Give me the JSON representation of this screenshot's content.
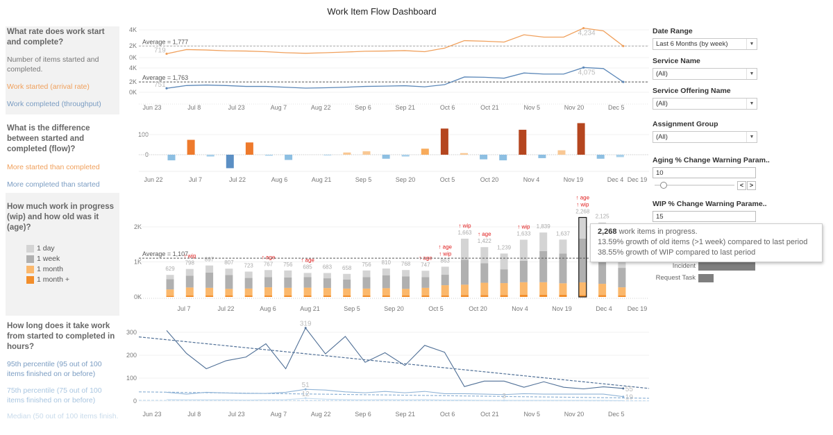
{
  "title": "Work Item Flow Dashboard",
  "left_panel": {
    "q1": {
      "heading": "What rate does work start and complete?",
      "sub": "Number of items started and completed.",
      "legend_started": "Work started (arrival rate)",
      "legend_completed": "Work completed (throughput)"
    },
    "q2": {
      "heading": "What is the difference between started and completed (flow)?",
      "more_started": "More started than completed",
      "more_completed": "More completed than started"
    },
    "q3": {
      "heading": "How much work in progress (wip) and how old was it (age)?",
      "legend": [
        {
          "label": "1 day",
          "color": "#d4d4d4"
        },
        {
          "label": "1 week",
          "color": "#b0b0b0"
        },
        {
          "label": "1 month",
          "color": "#fbb86c"
        },
        {
          "label": "1 month +",
          "color": "#f28e2b"
        }
      ]
    },
    "q4": {
      "heading": "How long does it take work from started to completed in hours?",
      "p95": "95th percentile (95 out of 100 items finished on or before)",
      "p75": "75th percentile (75 out of 100 items finished on or before)",
      "median": "Median (50 out of 100 items finish.."
    }
  },
  "filters": {
    "date_range": {
      "label": "Date Range",
      "value": "Last 6 Months (by week)"
    },
    "service_name": {
      "label": "Service Name",
      "value": "(All)"
    },
    "service_offering": {
      "label": "Service Offering Name",
      "value": "(All)"
    },
    "assignment_group": {
      "label": "Assignment Group",
      "value": "(All)"
    },
    "aging_param": {
      "label": "Aging % Change Warning Param..",
      "value": "10",
      "slider_fraction": 0.1,
      "prev": "<",
      "next": ">"
    },
    "wip_param": {
      "label": "WIP % Change Warning Parame..",
      "value": "15"
    }
  },
  "tooltip": {
    "count": "2,268",
    "line1": " work items in progress.",
    "line2": "13.59% growth of old items (>1 week) compared to last period",
    "line3": "38.55% growth of WIP compared to last period"
  },
  "type_bars": [
    {
      "label": "Incident",
      "relative": 1.0
    },
    {
      "label": "Request Task",
      "relative": 0.27
    }
  ],
  "colors": {
    "started": "#f0a05c",
    "completed": "#5b87b8",
    "warning": "#e02020"
  },
  "chart_data": [
    {
      "type": "line",
      "x_ticks": [
        "Jun 23",
        "Jul 8",
        "Jul 23",
        "Aug 7",
        "Aug 22",
        "Sep 6",
        "Sep 21",
        "Oct 6",
        "Oct 21",
        "Nov 5",
        "Nov 20",
        "Dec 5"
      ],
      "y_ticks": [
        "4K",
        "2K",
        "0K"
      ],
      "series": [
        {
          "name": "Work started (arrival rate)",
          "color": "#f0a05c",
          "average_label": "Average = 1,777",
          "average": 1777,
          "values": [
            719,
            1290,
            1230,
            1120,
            1090,
            1000,
            860,
            780,
            860,
            950,
            1060,
            1090,
            1150,
            1000,
            1490,
            2520,
            2440,
            2320,
            3320,
            3000,
            3000,
            4234,
            3860,
            1777
          ],
          "labels": {
            "0": "719",
            "21": "4,234"
          }
        },
        {
          "name": "Work completed (throughput)",
          "color": "#5b87b8",
          "average_label": "Average = 1,763",
          "average": 1763,
          "values": [
            751,
            1190,
            1270,
            1190,
            1050,
            1050,
            920,
            780,
            830,
            920,
            1050,
            1100,
            1160,
            990,
            1330,
            2560,
            2510,
            2370,
            3200,
            3030,
            3030,
            4075,
            3910,
            1763
          ],
          "labels": {
            "0": "751",
            "21": "4,075"
          }
        }
      ]
    },
    {
      "type": "bar",
      "x_ticks": [
        "Jun 22",
        "Jul 7",
        "Jul 22",
        "Aug 6",
        "Aug 21",
        "Sep 5",
        "Sep 20",
        "Oct 5",
        "Oct 20",
        "Nov 4",
        "Nov 19",
        "Dec 4",
        "Dec 19"
      ],
      "y_ticks": [
        {
          "label": "100",
          "value": 100
        },
        {
          "label": "0",
          "value": 0
        }
      ],
      "values": [
        -28,
        74,
        -9,
        -67,
        61,
        -5,
        -26,
        0,
        -2,
        11,
        17,
        -20,
        -9,
        30,
        130,
        8,
        -23,
        -28,
        124,
        -17,
        22,
        157,
        -20,
        -12
      ]
    },
    {
      "type": "bar",
      "stacked": true,
      "x_ticks": [
        "Jul 7",
        "Jul 22",
        "Aug 6",
        "Aug 21",
        "Sep 5",
        "Sep 20",
        "Oct 5",
        "Oct 20",
        "Nov 4",
        "Nov 19",
        "Dec 4",
        "Dec 19"
      ],
      "y_ticks": [
        {
          "label": "2K",
          "value": 2000
        },
        {
          "label": "1K",
          "value": 1000
        },
        {
          "label": "0K",
          "value": 0
        }
      ],
      "average_label": "Average = 1,107",
      "average": 1107,
      "totals": [
        629,
        798,
        897,
        807,
        723,
        767,
        756,
        685,
        683,
        658,
        756,
        810,
        768,
        747,
        863,
        1663,
        1422,
        1239,
        1633,
        1839,
        1637,
        2268,
        2125,
        1050
      ],
      "total_labels": [
        "629",
        "798",
        "897",
        "807",
        "723",
        "767",
        "756",
        "685",
        "683",
        "658",
        "756",
        "810",
        "768",
        "747",
        "863",
        "1,663",
        "1,422",
        "1,239",
        "1,633",
        "1,839",
        "1,637",
        "2,268",
        "2,125",
        ""
      ],
      "series": [
        {
          "name": "1 month +",
          "color": "#f28e2b",
          "values": [
            35,
            40,
            40,
            40,
            40,
            45,
            40,
            45,
            45,
            40,
            40,
            40,
            40,
            40,
            45,
            50,
            55,
            55,
            60,
            60,
            60,
            55,
            55,
            45
          ]
        },
        {
          "name": "1 month",
          "color": "#fbb86c",
          "values": [
            180,
            230,
            220,
            190,
            200,
            230,
            220,
            220,
            210,
            200,
            200,
            210,
            190,
            220,
            290,
            300,
            350,
            340,
            360,
            360,
            330,
            360,
            320,
            230
          ]
        },
        {
          "name": "1 week",
          "color": "#b0b0b0",
          "values": [
            294,
            338,
            437,
            397,
            303,
            292,
            296,
            300,
            278,
            258,
            326,
            370,
            358,
            307,
            298,
            713,
            557,
            394,
            613,
            889,
            847,
            1253,
            1300,
            555
          ]
        },
        {
          "name": "1 day",
          "color": "#d4d4d4",
          "values": [
            120,
            190,
            200,
            180,
            180,
            200,
            200,
            120,
            150,
            160,
            190,
            190,
            180,
            180,
            230,
            600,
            460,
            450,
            600,
            530,
            400,
            600,
            450,
            220
          ]
        }
      ],
      "selected_index": 21,
      "annotations": {
        "1": [
          "↑ wip"
        ],
        "5": [
          "↑ age"
        ],
        "7": [
          "↑ age"
        ],
        "13": [
          "↑ age"
        ],
        "14": [
          "↑ age",
          "↑ wip"
        ],
        "15": [
          "↑ wip"
        ],
        "16": [
          "↑ age"
        ],
        "18": [
          "↑ wip"
        ],
        "21": [
          "↑ age",
          "↑ wip"
        ]
      }
    },
    {
      "type": "line",
      "x_ticks": [
        "Jun 23",
        "Jul 8",
        "Jul 23",
        "Aug 7",
        "Aug 22",
        "Sep 6",
        "Sep 21",
        "Oct 6",
        "Oct 21",
        "Nov 5",
        "Nov 20",
        "Dec 5"
      ],
      "y_ticks": [
        {
          "label": "300",
          "value": 300
        },
        {
          "label": "200",
          "value": 200
        },
        {
          "label": "100",
          "value": 100
        },
        {
          "label": "0",
          "value": 0
        }
      ],
      "series": [
        {
          "name": "95th percentile",
          "color": "#4f6f96",
          "trend": [
            280,
            55
          ],
          "values": [
            308,
            208,
            141,
            176,
            192,
            250,
            141,
            319,
            206,
            282,
            169,
            211,
            155,
            243,
            213,
            63,
            87,
            87,
            60,
            84,
            60,
            53,
            62,
            55
          ],
          "labels": {
            "7": "319",
            "23": "55"
          }
        },
        {
          "name": "75th percentile",
          "color": "#8fb3d6",
          "trend": [
            40,
            12
          ],
          "values": [
            38,
            30,
            38,
            35,
            33,
            33,
            38,
            51,
            48,
            40,
            36,
            42,
            36,
            42,
            32,
            32,
            30,
            28,
            32,
            30,
            30,
            30,
            30,
            19
          ],
          "labels": {
            "7": "51",
            "23": "19"
          }
        },
        {
          "name": "Median",
          "color": "#c5dcef",
          "trend": [
            3,
            1
          ],
          "values": [
            6,
            5,
            5,
            5,
            4,
            5,
            6,
            12,
            8,
            6,
            5,
            6,
            5,
            6,
            4,
            4,
            3,
            3,
            3,
            3,
            3,
            3,
            3,
            2
          ],
          "labels": {
            "7": "12",
            "17": "3"
          }
        }
      ]
    }
  ]
}
